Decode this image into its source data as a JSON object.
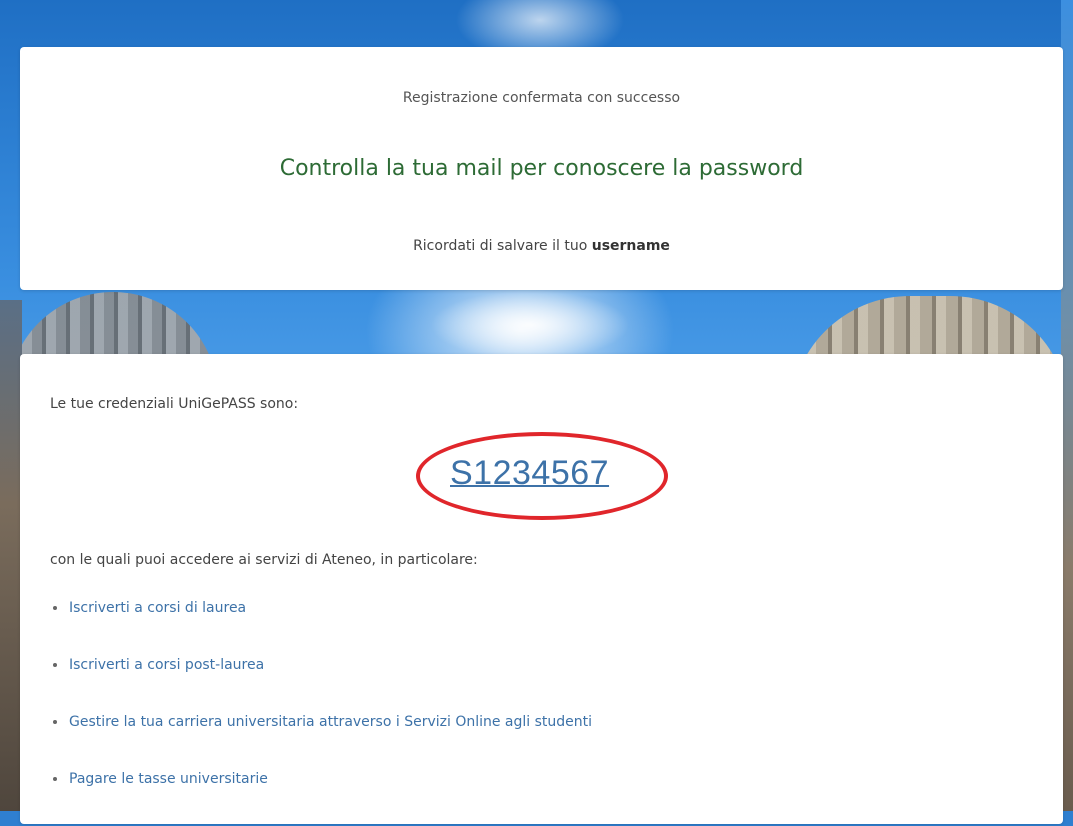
{
  "confirmation": {
    "status": "Registrazione confermata con successo",
    "headline": "Controlla la tua mail per conoscere la password",
    "reminder_prefix": "Ricordati di salvare il tuo ",
    "reminder_bold": "username"
  },
  "credentials": {
    "intro": "Le tue credenziali UniGePASS sono:",
    "username": "S1234567",
    "services_intro": "con le quali puoi accedere ai servizi di Ateneo, in particolare:",
    "services": [
      {
        "label": "Iscriverti a corsi di laurea"
      },
      {
        "label": "Iscriverti a corsi post-laurea"
      },
      {
        "label": "Gestire la tua carriera universitaria attraverso i Servizi Online agli studenti"
      },
      {
        "label": "Pagare le tasse universitarie"
      }
    ]
  },
  "colors": {
    "headline": "#2d6b35",
    "link": "#3d72a8",
    "highlight_ellipse": "#e0262b"
  }
}
